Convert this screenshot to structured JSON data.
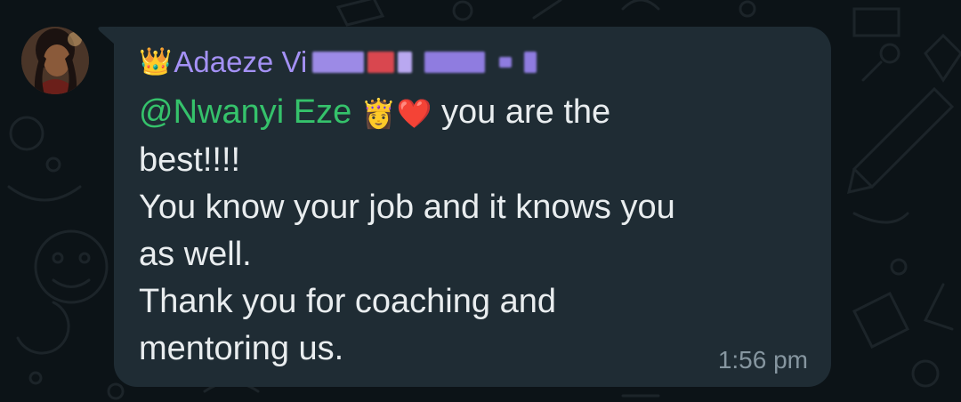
{
  "chat": {
    "message": {
      "sender_emoji": "👑",
      "sender_name": "Adaeze Vi",
      "mention": "@Nwanyi Eze",
      "mention_emojis": "👸❤️",
      "line1": " you are the",
      "line2": "best!!!!",
      "line3": "You know your job and it knows you",
      "line4": "as well.",
      "line5": "Thank you for coaching and",
      "line6": "mentoring us.",
      "time": "1:56 pm"
    }
  },
  "colors": {
    "background": "#0c1317",
    "bubble": "#1f2c34",
    "sender_name": "#a491f5",
    "mention": "#35c26b",
    "text": "#e9edef",
    "timestamp": "#8696a0"
  },
  "icons": {
    "wallpaper": "doodle-pattern",
    "avatar": "profile-photo"
  }
}
